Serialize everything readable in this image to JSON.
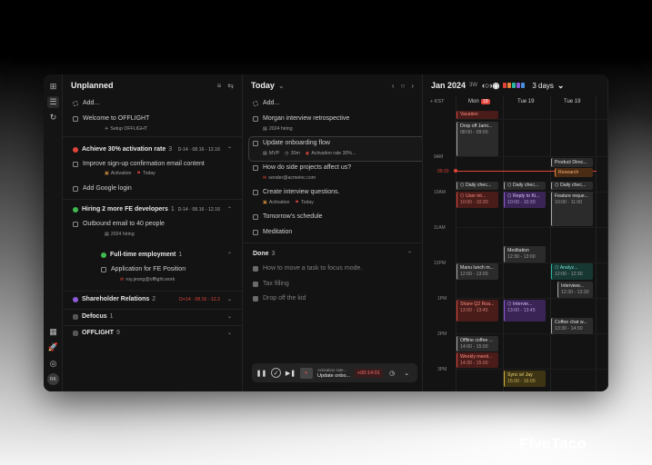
{
  "brand": "FiveTaco",
  "rail": {
    "avatar": "RK"
  },
  "unplanned": {
    "title": "Unplanned",
    "add": "Add...",
    "tasks": [
      {
        "label": "Welcome to OFFLIGHT",
        "sub": "Setup OFFLIGHT"
      }
    ],
    "groups": [
      {
        "name": "Achieve 30% activation rate",
        "count": "3",
        "dates": "D-14 · 08.16 - 12.16",
        "color": "#e0443a",
        "tasks": [
          {
            "label": "Improve sign-up confirmation email content",
            "sub1": "Activation",
            "sub2": "Today"
          },
          {
            "label": "Add Google login"
          }
        ]
      },
      {
        "name": "Hiring 2 more FE developers",
        "count": "1",
        "dates": "D-14 · 08.16 - 12.16",
        "color": "#3fb950",
        "tasks": [
          {
            "label": "Outbound email to 40 people",
            "sub1": "2024 hiring"
          }
        ]
      },
      {
        "name": "Full-time employment",
        "count": "1",
        "color": "#3fb950",
        "tasks": [
          {
            "label": "Application for FE Position",
            "sub1": "roy.jeong@offlight.work"
          }
        ]
      },
      {
        "name": "Shareholder Relations",
        "count": "2",
        "dates": "D+14 · 08.16 - 12.2",
        "color": "#8c5ad8"
      },
      {
        "name": "Defocus",
        "count": "1",
        "color": "#8a8a8a"
      },
      {
        "name": "OFFLIGHT",
        "count": "9",
        "color": "#8a8a8a"
      }
    ]
  },
  "today": {
    "title": "Today",
    "add": "Add...",
    "tasks": [
      {
        "label": "Morgan interview retrospective",
        "sub1": "2024 hiring"
      },
      {
        "label": "Update onboarding flow",
        "sub1": "MVP",
        "sub2": "30m",
        "sub3": "Activation rate 30%..."
      },
      {
        "label": "How do side projects affect us?",
        "sub1": "sender@acmeinc.com"
      },
      {
        "label": "Create interview questions.",
        "sub1": "Activation",
        "sub2": "Today"
      },
      {
        "label": "Tomorrow's schedule"
      },
      {
        "label": "Meditation"
      }
    ],
    "done_title": "Done",
    "done_count": "3",
    "done": [
      "How to move a task to focus mode.",
      "Tax filling",
      "Drop off the kid"
    ],
    "player": {
      "project": "Activation rate...",
      "task": "Update onbo...",
      "timer": "+00:14:01"
    }
  },
  "calendar": {
    "month": "Jan 2024",
    "week": "3W",
    "range": "3 days",
    "tz": "KST",
    "days": [
      {
        "name": "Mon",
        "num": "18"
      },
      {
        "name": "Tue",
        "num": "19"
      },
      {
        "name": "Tue",
        "num": "19"
      }
    ],
    "times": [
      "9AM",
      "09:20",
      "10AM",
      "11AM",
      "12PM",
      "1PM",
      "2PM",
      "3PM"
    ],
    "allday": {
      "title": "Vacation"
    },
    "events": [
      {
        "title": "Drop off Jami...",
        "time": "08:00 - 09:00"
      },
      {
        "title": "Product Direc..."
      },
      {
        "title": "Research"
      },
      {
        "title": "Daily chec..."
      },
      {
        "title": "Daily chec..."
      },
      {
        "title": "Daily chec..."
      },
      {
        "title": "User int...",
        "time": "10:00 - 10:30"
      },
      {
        "title": "Reply to Ki...",
        "time": "10:00 - 10:30"
      },
      {
        "title": "Feature reque...",
        "time": "10:00 - 11:00"
      },
      {
        "title": "Meditation",
        "time": "12:30 - 13:00"
      },
      {
        "title": "Manu lunch m...",
        "time": "12:00 - 13:00"
      },
      {
        "title": "Analyz...",
        "time": "12:00 - 12:30"
      },
      {
        "title": "Interview...",
        "time": "12:30 - 13:30"
      },
      {
        "title": "Share Q2 Roa...",
        "time": "13:00 - 13:45"
      },
      {
        "title": "Intervie...",
        "time": "13:00 - 13:45"
      },
      {
        "title": "Coffee chat w...",
        "time": "13:30 - 14:30"
      },
      {
        "title": "Offline coffee ...",
        "time": "14:00 - 15:00"
      },
      {
        "title": "Weekly meeti...",
        "time": "14:30 - 15:00"
      },
      {
        "title": "Sync w/ Jay",
        "time": "15:00 - 16:00"
      }
    ]
  }
}
